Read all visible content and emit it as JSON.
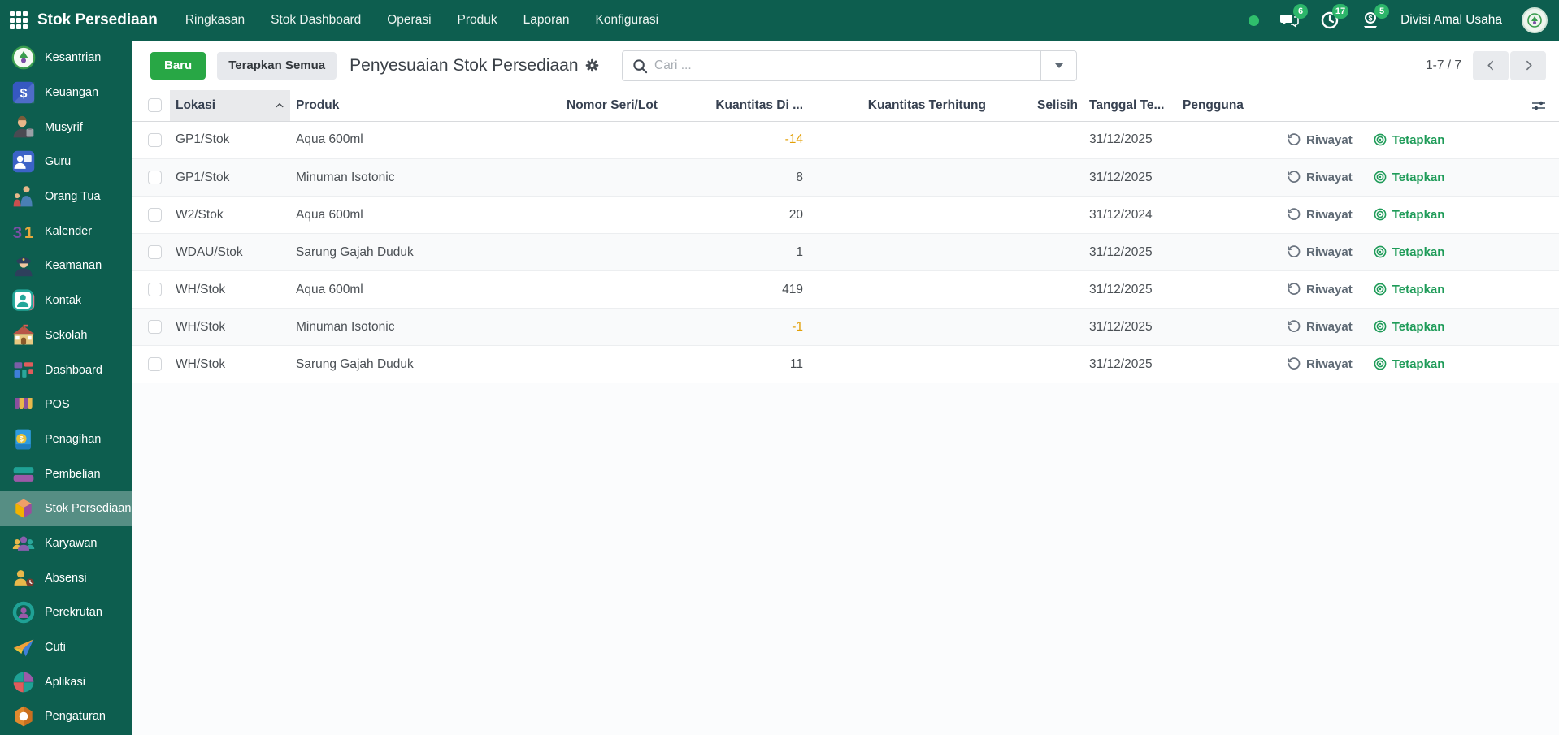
{
  "navbar": {
    "app_title": "Stok Persediaan",
    "menus": [
      "Ringkasan",
      "Stok Dashboard",
      "Operasi",
      "Produk",
      "Laporan",
      "Konfigurasi"
    ],
    "message_badge": "6",
    "activity_badge": "17",
    "money_badge": "5",
    "company": "Divisi Amal Usaha"
  },
  "sidebar": {
    "items": [
      {
        "label": "Kesantrian",
        "icon": "kesantrian-app-icon",
        "active": false
      },
      {
        "label": "Keuangan",
        "icon": "keuangan-app-icon",
        "active": false
      },
      {
        "label": "Musyrif",
        "icon": "musyrif-app-icon",
        "active": false
      },
      {
        "label": "Guru",
        "icon": "guru-app-icon",
        "active": false
      },
      {
        "label": "Orang Tua",
        "icon": "orang-tua-app-icon",
        "active": false
      },
      {
        "label": "Kalender",
        "icon": "kalender-app-icon",
        "active": false
      },
      {
        "label": "Keamanan",
        "icon": "keamanan-app-icon",
        "active": false
      },
      {
        "label": "Kontak",
        "icon": "kontak-app-icon",
        "active": false
      },
      {
        "label": "Sekolah",
        "icon": "sekolah-app-icon",
        "active": false
      },
      {
        "label": "Dashboard",
        "icon": "dashboard-app-icon",
        "active": false
      },
      {
        "label": "POS",
        "icon": "pos-app-icon",
        "active": false
      },
      {
        "label": "Penagihan",
        "icon": "penagihan-app-icon",
        "active": false
      },
      {
        "label": "Pembelian",
        "icon": "pembelian-app-icon",
        "active": false
      },
      {
        "label": "Stok Persediaan",
        "icon": "stok-persediaan-app-icon",
        "active": true
      },
      {
        "label": "Karyawan",
        "icon": "karyawan-app-icon",
        "active": false
      },
      {
        "label": "Absensi",
        "icon": "absensi-app-icon",
        "active": false
      },
      {
        "label": "Perekrutan",
        "icon": "perekrutan-app-icon",
        "active": false
      },
      {
        "label": "Cuti",
        "icon": "cuti-app-icon",
        "active": false
      },
      {
        "label": "Aplikasi",
        "icon": "aplikasi-app-icon",
        "active": false
      },
      {
        "label": "Pengaturan",
        "icon": "pengaturan-app-icon",
        "active": false
      }
    ]
  },
  "control_panel": {
    "new_button": "Baru",
    "apply_all_button": "Terapkan Semua",
    "title": "Penyesuaian Stok Persediaan",
    "search_placeholder": "Cari ...",
    "pager_text": "1-7 / 7"
  },
  "table": {
    "columns": [
      "Lokasi",
      "Produk",
      "Nomor Seri/Lot",
      "Kuantitas Di ...",
      "Kuantitas Terhitung",
      "Selisih",
      "Tanggal Te...",
      "Pengguna"
    ],
    "sorted_column": "Lokasi",
    "history_label": "Riwayat",
    "apply_label": "Tetapkan",
    "rows": [
      {
        "lokasi": "GP1/Stok",
        "produk": "Aqua 600ml",
        "nomor_seri": "",
        "kuantitas_di": "-14",
        "kuantitas_terhitung": "",
        "selisih": "",
        "tanggal": "31/12/2025",
        "pengguna": "",
        "negative": true
      },
      {
        "lokasi": "GP1/Stok",
        "produk": "Minuman Isotonic",
        "nomor_seri": "",
        "kuantitas_di": "8",
        "kuantitas_terhitung": "",
        "selisih": "",
        "tanggal": "31/12/2025",
        "pengguna": "",
        "negative": false
      },
      {
        "lokasi": "W2/Stok",
        "produk": "Aqua 600ml",
        "nomor_seri": "",
        "kuantitas_di": "20",
        "kuantitas_terhitung": "",
        "selisih": "",
        "tanggal": "31/12/2024",
        "pengguna": "",
        "negative": false
      },
      {
        "lokasi": "WDAU/Stok",
        "produk": "Sarung Gajah Duduk",
        "nomor_seri": "",
        "kuantitas_di": "1",
        "kuantitas_terhitung": "",
        "selisih": "",
        "tanggal": "31/12/2025",
        "pengguna": "",
        "negative": false
      },
      {
        "lokasi": "WH/Stok",
        "produk": "Aqua 600ml",
        "nomor_seri": "",
        "kuantitas_di": "419",
        "kuantitas_terhitung": "",
        "selisih": "",
        "tanggal": "31/12/2025",
        "pengguna": "",
        "negative": false
      },
      {
        "lokasi": "WH/Stok",
        "produk": "Minuman Isotonic",
        "nomor_seri": "",
        "kuantitas_di": "-1",
        "kuantitas_terhitung": "",
        "selisih": "",
        "tanggal": "31/12/2025",
        "pengguna": "",
        "negative": true
      },
      {
        "lokasi": "WH/Stok",
        "produk": "Sarung Gajah Duduk",
        "nomor_seri": "",
        "kuantitas_di": "11",
        "kuantitas_terhitung": "",
        "selisih": "",
        "tanggal": "31/12/2025",
        "pengguna": "",
        "negative": false
      }
    ]
  },
  "colors": {
    "navbar_bg": "#0d5e4f",
    "sidebar_active_bg": "#569385",
    "new_button_green": "#28a745",
    "badge_green": "#2cb56a",
    "negative_amber": "#e3a008",
    "apply_link_green": "#1e9b58"
  }
}
